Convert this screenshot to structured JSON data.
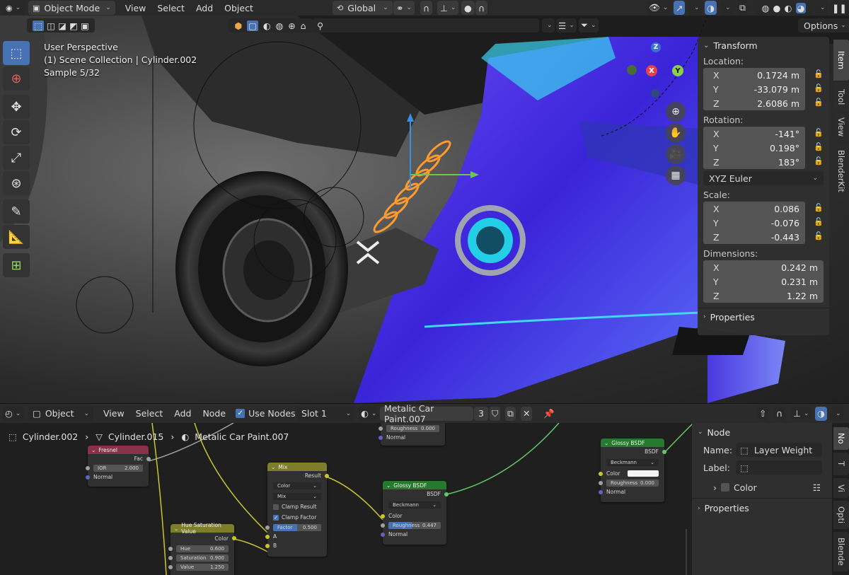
{
  "header": {
    "mode": "Object Mode",
    "menus": [
      "View",
      "Select",
      "Add",
      "Object"
    ],
    "orientation": "Global",
    "options": "Options"
  },
  "viewport": {
    "info": [
      "User Perspective",
      "(1) Scene Collection | Cylinder.002",
      "Sample 5/32"
    ],
    "gizmo": {
      "x": "X",
      "y": "Y",
      "z": "Z"
    }
  },
  "npanel": {
    "title": "Transform",
    "location_label": "Location:",
    "location": [
      {
        "axis": "X",
        "value": "0.1724 m"
      },
      {
        "axis": "Y",
        "value": "-33.079 m"
      },
      {
        "axis": "Z",
        "value": "2.6086 m"
      }
    ],
    "rotation_label": "Rotation:",
    "rotation": [
      {
        "axis": "X",
        "value": "-141°"
      },
      {
        "axis": "Y",
        "value": "0.198°"
      },
      {
        "axis": "Z",
        "value": "183°"
      }
    ],
    "rotation_mode": "XYZ Euler",
    "scale_label": "Scale:",
    "scale": [
      {
        "axis": "X",
        "value": "0.086"
      },
      {
        "axis": "Y",
        "value": "-0.076"
      },
      {
        "axis": "Z",
        "value": "-0.443"
      }
    ],
    "dimensions_label": "Dimensions:",
    "dimensions": [
      {
        "axis": "X",
        "value": "0.242 m"
      },
      {
        "axis": "Y",
        "value": "0.231 m"
      },
      {
        "axis": "Z",
        "value": "1.22 m"
      }
    ],
    "properties": "Properties",
    "tabs": [
      "Item",
      "Tool",
      "View",
      "BlenderKit"
    ]
  },
  "node_header": {
    "editor": "Object",
    "menus": [
      "View",
      "Select",
      "Add",
      "Node"
    ],
    "use_nodes": "Use Nodes",
    "slot": "Slot 1",
    "material": "Metalic Car Paint.007",
    "users": "3"
  },
  "breadcrumb": [
    "Cylinder.002",
    "Cylinder.015",
    "Metalic Car Paint.007"
  ],
  "nodes": {
    "fresnel": {
      "title": "Fresnel",
      "out": "Fac",
      "ior_label": "IOR",
      "ior": "2.000",
      "normal": "Normal"
    },
    "top": {
      "roughness_label": "Roughness",
      "roughness": "0.000",
      "normal": "Normal"
    },
    "mix": {
      "title": "Mix",
      "out": "Result",
      "dd1": "Color",
      "dd2": "Mix",
      "clamp_result": "Clamp Result",
      "clamp_factor": "Clamp Factor",
      "factor_label": "Factor",
      "factor": "0.500",
      "a": "A",
      "b": "B"
    },
    "glossy1": {
      "title": "Glossy BSDF",
      "out": "BSDF",
      "dist": "Beckmann",
      "color": "Color",
      "roughness_label": "Roughness",
      "roughness": "0.447",
      "normal": "Normal"
    },
    "glossy2": {
      "title": "Glossy BSDF",
      "out": "BSDF",
      "dist": "Beckmann",
      "color": "Color",
      "roughness_label": "Roughness",
      "roughness": "0.000",
      "normal": "Normal"
    },
    "hsv": {
      "title": "Hue Saturation Value",
      "out": "Color",
      "hue_label": "Hue",
      "hue": "0.600",
      "sat_label": "Saturation",
      "sat": "0.900",
      "val_label": "Value",
      "val": "1.250"
    }
  },
  "node_side": {
    "title": "Node",
    "name_label": "Name:",
    "name": "Layer Weight",
    "label_label": "Label:",
    "color": "Color",
    "properties": "Properties",
    "tabs": [
      "No",
      "T",
      "Vi",
      "Opti",
      "Blende"
    ]
  }
}
